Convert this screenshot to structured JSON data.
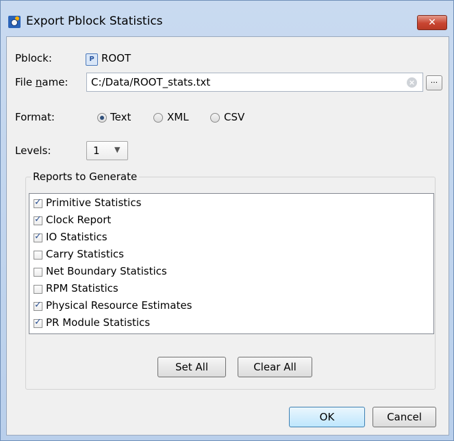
{
  "window": {
    "title": "Export Pblock Statistics",
    "close_label": "✕"
  },
  "pblock": {
    "label": "Pblock:",
    "icon_glyph": "P",
    "value": "ROOT"
  },
  "file": {
    "label_prefix": "File ",
    "label_underlined": "n",
    "label_suffix": "ame:",
    "value": "C:/Data/ROOT_stats.txt",
    "browse_label": "..."
  },
  "format": {
    "label": "Format:",
    "options": [
      {
        "label": "Text",
        "selected": true
      },
      {
        "label": "XML",
        "selected": false
      },
      {
        "label": "CSV",
        "selected": false
      }
    ]
  },
  "levels": {
    "label": "Levels:",
    "value": "1"
  },
  "reports": {
    "title": "Reports to Generate",
    "items": [
      {
        "label": "Primitive Statistics",
        "checked": true
      },
      {
        "label": "Clock Report",
        "checked": true
      },
      {
        "label": "IO Statistics",
        "checked": true
      },
      {
        "label": "Carry Statistics",
        "checked": false
      },
      {
        "label": "Net Boundary Statistics",
        "checked": false
      },
      {
        "label": "RPM Statistics",
        "checked": false
      },
      {
        "label": "Physical Resource Estimates",
        "checked": true
      },
      {
        "label": "PR Module Statistics",
        "checked": true
      }
    ],
    "set_all": "Set All",
    "clear_all": "Clear All"
  },
  "actions": {
    "ok": "OK",
    "cancel": "Cancel"
  },
  "colors": {
    "titlebar": "#c9daf0",
    "close": "#c84531",
    "client": "#f0f0f0",
    "accent": "#3c7fb1"
  }
}
